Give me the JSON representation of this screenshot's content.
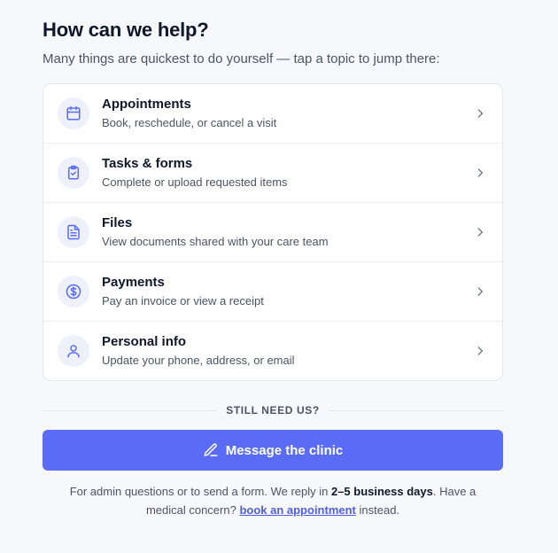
{
  "header": {
    "title": "How can we help?",
    "subtitle": "Many things are quickest to do yourself — tap a topic to jump there:"
  },
  "topics": [
    {
      "title": "Appointments",
      "description": "Book, reschedule, or cancel a visit",
      "icon": "calendar-icon"
    },
    {
      "title": "Tasks & forms",
      "description": "Complete or upload requested items",
      "icon": "clipboard-check-icon"
    },
    {
      "title": "Files",
      "description": "View documents shared with your care team",
      "icon": "document-icon"
    },
    {
      "title": "Payments",
      "description": "Pay an invoice or view a receipt",
      "icon": "dollar-circle-icon"
    },
    {
      "title": "Personal info",
      "description": "Update your phone, address, or email",
      "icon": "user-icon"
    }
  ],
  "divider_label": "STILL NEED US?",
  "cta": {
    "label": "Message the clinic",
    "icon": "pencil-icon"
  },
  "footnote": {
    "part1": "For admin questions or to send a form. We reply in ",
    "emphasis": "2–5 business days",
    "part2": ". Have a medical concern? ",
    "link_text": "book an appointment",
    "part3": " instead."
  },
  "colors": {
    "accent": "#5a6cf5",
    "icon_bg": "#eef0fb",
    "icon_stroke": "#5a6cf5",
    "link": "#4f5fe8"
  }
}
